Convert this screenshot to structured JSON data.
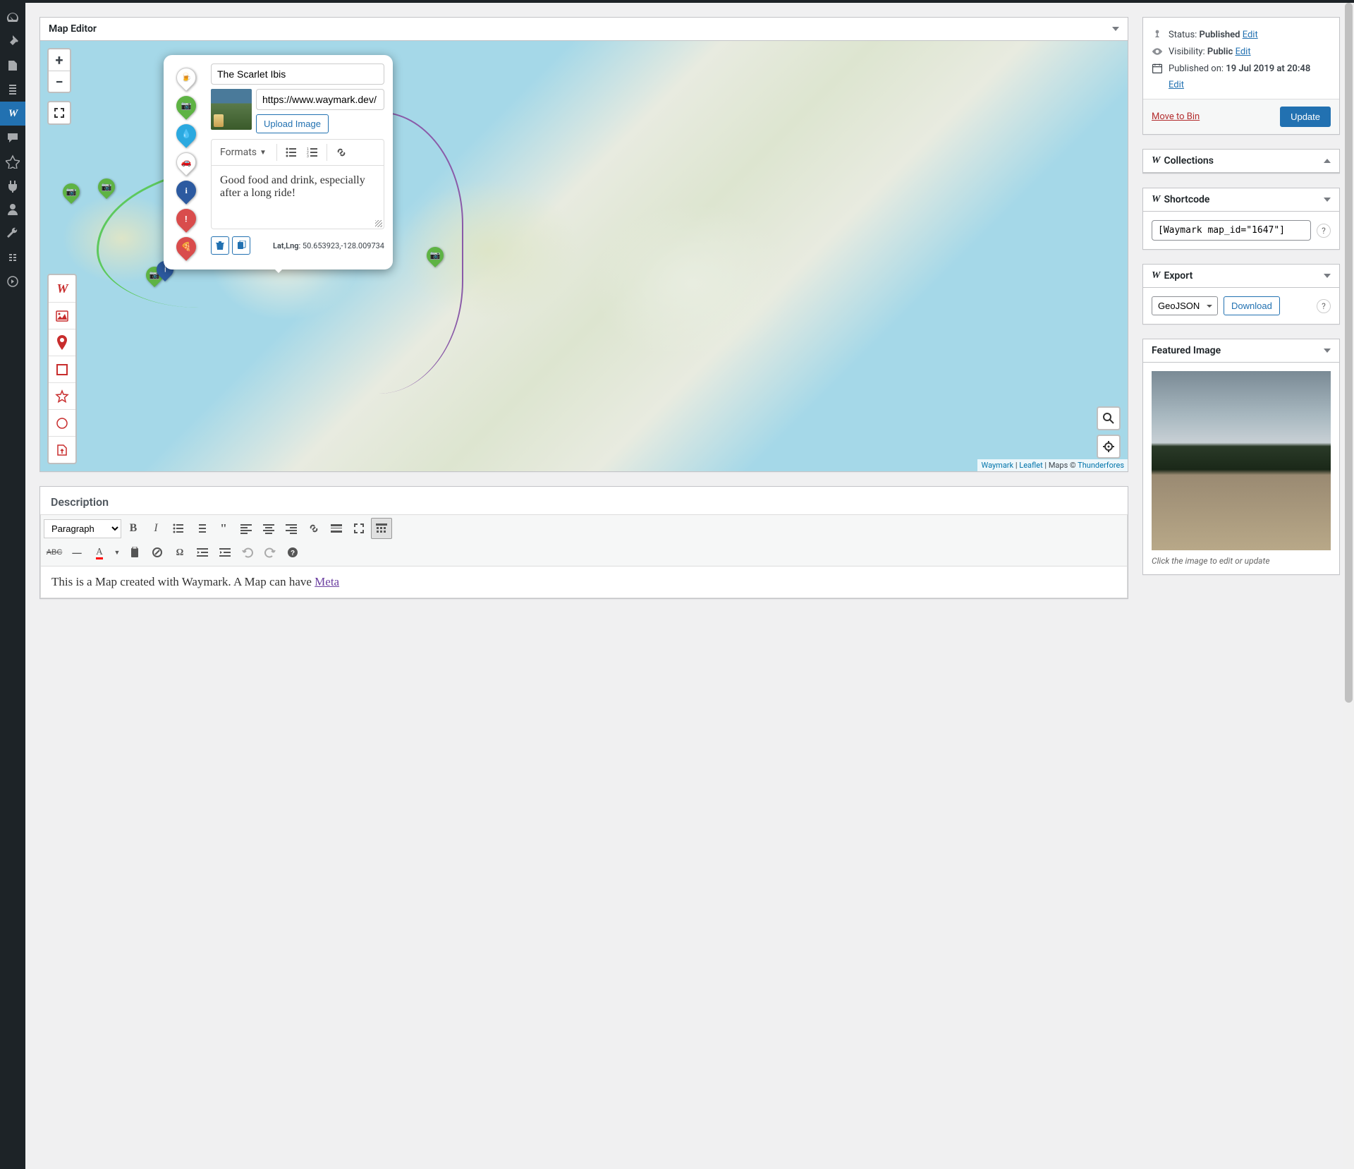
{
  "mapEditor": {
    "title": "Map Editor",
    "attribution": {
      "waymark": "Waymark",
      "leaflet": "Leaflet",
      "maps_prefix": " | Maps © ",
      "provider": "Thunderfores"
    },
    "popup": {
      "title_value": "The Scarlet Ibis",
      "image_url_value": "https://www.waymark.dev/",
      "upload_label": "Upload Image",
      "formats_label": "Formats",
      "description_value": "Good food and drink, especially after a long ride!",
      "latlng_label": "Lat,Lng",
      "latlng_value": ": 50.653923,-128.009734"
    }
  },
  "description": {
    "heading": "Description",
    "format_select": "Paragraph",
    "body_text": "This is a Map created with Waymark. A Map can have ",
    "body_link": "Meta"
  },
  "publish": {
    "status_label": "Status: ",
    "status_value": "Published",
    "visibility_label": "Visibility: ",
    "visibility_value": "Public",
    "published_label": "Published on: ",
    "published_value": "19 Jul 2019 at 20:48",
    "edit": "Edit",
    "move_to_bin": "Move to Bin",
    "update": "Update"
  },
  "collections": {
    "title": "Collections"
  },
  "shortcode": {
    "title": "Shortcode",
    "value": "[Waymark map_id=\"1647\"]"
  },
  "export": {
    "title": "Export",
    "format": "GeoJSON",
    "download": "Download"
  },
  "featured": {
    "title": "Featured Image",
    "caption": "Click the image to edit or update"
  }
}
